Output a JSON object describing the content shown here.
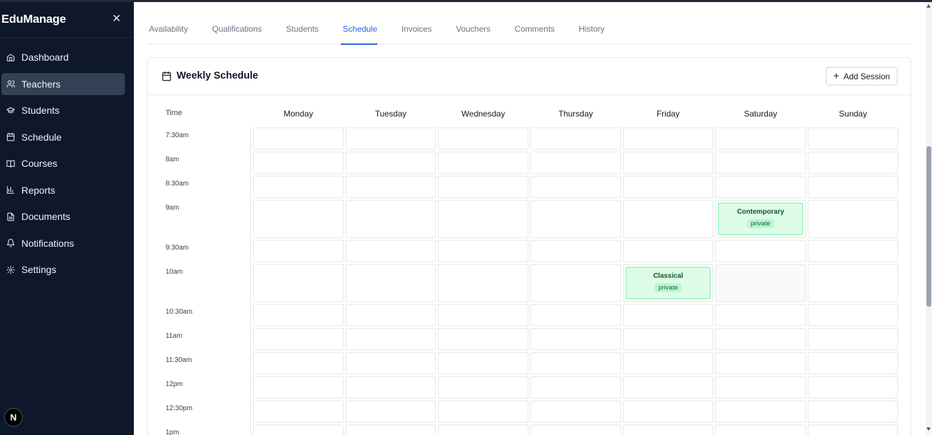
{
  "app": {
    "brand": "EduManage",
    "close_icon": "close-icon",
    "avatar_letter": "N"
  },
  "sidebar": {
    "items": [
      {
        "label": "Dashboard",
        "icon": "home-icon",
        "active": false
      },
      {
        "label": "Teachers",
        "icon": "users-icon",
        "active": true
      },
      {
        "label": "Students",
        "icon": "graduation-cap-icon",
        "active": false
      },
      {
        "label": "Schedule",
        "icon": "calendar-icon",
        "active": false
      },
      {
        "label": "Courses",
        "icon": "book-icon",
        "active": false
      },
      {
        "label": "Reports",
        "icon": "bar-chart-icon",
        "active": false
      },
      {
        "label": "Documents",
        "icon": "file-text-icon",
        "active": false
      },
      {
        "label": "Notifications",
        "icon": "bell-icon",
        "active": false
      },
      {
        "label": "Settings",
        "icon": "gear-icon",
        "active": false
      }
    ]
  },
  "tabs": [
    {
      "label": "Availability",
      "active": false
    },
    {
      "label": "Qualifications",
      "active": false
    },
    {
      "label": "Students",
      "active": false
    },
    {
      "label": "Schedule",
      "active": true
    },
    {
      "label": "Invoices",
      "active": false
    },
    {
      "label": "Vouchers",
      "active": false
    },
    {
      "label": "Comments",
      "active": false
    },
    {
      "label": "History",
      "active": false
    }
  ],
  "schedule": {
    "title": "Weekly Schedule",
    "add_button": "Add Session",
    "time_header": "Time",
    "days": [
      "Monday",
      "Tuesday",
      "Wednesday",
      "Thursday",
      "Friday",
      "Saturday",
      "Sunday"
    ],
    "times": [
      "7:30am",
      "8am",
      "8:30am",
      "9am",
      "9:30am",
      "10am",
      "10:30am",
      "11am",
      "11:30am",
      "12pm",
      "12:30pm",
      "1pm"
    ],
    "sessions": [
      {
        "time": "9am",
        "day": "Saturday",
        "title": "Contemporary",
        "type": "private"
      },
      {
        "time": "10am",
        "day": "Friday",
        "title": "Classical",
        "type": "private"
      }
    ],
    "muted_slots": [
      {
        "time": "10am",
        "day": "Saturday"
      }
    ]
  },
  "colors": {
    "sidebar_bg": "#0f172a",
    "accent": "#2563eb",
    "session_bg": "#dcfce7",
    "session_border": "#86efac"
  }
}
